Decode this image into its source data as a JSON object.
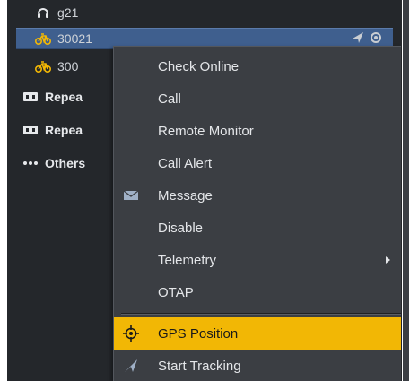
{
  "tree": {
    "items": [
      {
        "label": "g21",
        "icon": "headset-icon"
      },
      {
        "label": "30021",
        "icon": "bicycle-icon",
        "selected": true
      },
      {
        "label": "300",
        "icon": "bicycle-icon"
      },
      {
        "label": "Repea",
        "icon": "repeater-icon"
      },
      {
        "label": "Repea",
        "icon": "repeater-icon"
      },
      {
        "label": "Others",
        "icon": "ellipsis-icon"
      }
    ]
  },
  "menu": {
    "items": [
      {
        "label": "Check Online"
      },
      {
        "label": "Call"
      },
      {
        "label": "Remote Monitor"
      },
      {
        "label": "Call Alert"
      },
      {
        "label": "Message",
        "icon": "envelope-icon"
      },
      {
        "label": "Disable"
      },
      {
        "label": "Telemetry",
        "submenu": true
      },
      {
        "label": "OTAP"
      },
      {
        "label": "GPS Position",
        "icon": "crosshair-icon",
        "highlighted": true
      },
      {
        "label": "Start Tracking",
        "icon": "send-arrow-icon"
      }
    ]
  },
  "colors": {
    "panel_bg": "#24272b",
    "selection": "#3f5f8e",
    "menu_bg": "#3b3e43",
    "highlight": "#f2b705",
    "bike_icon": "#f2b705"
  }
}
